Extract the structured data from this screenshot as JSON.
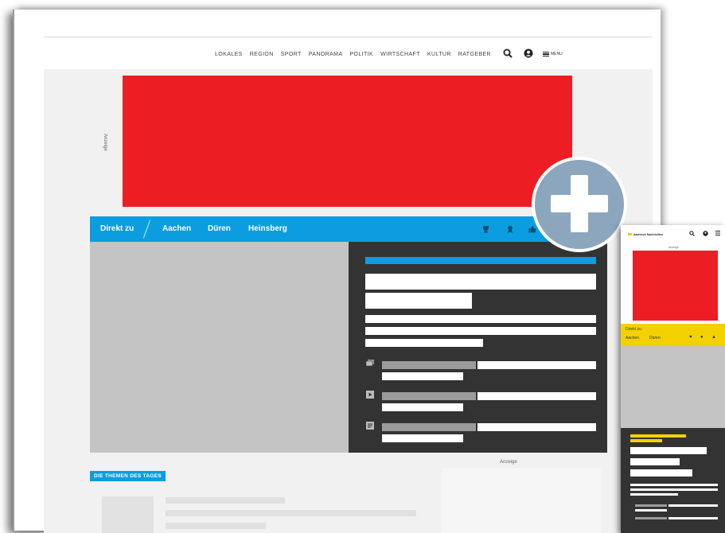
{
  "nav": {
    "items": [
      "LOKALES",
      "REGION",
      "SPORT",
      "PANORAMA",
      "POLITIK",
      "WIRTSCHAFT",
      "KULTUR",
      "RATGEBER"
    ],
    "menu_label": "MENU"
  },
  "ad": {
    "label": "Anzeige"
  },
  "quicklinks": {
    "label": "Direkt zu",
    "cities": [
      "Aachen",
      "Düren",
      "Heinsberg"
    ]
  },
  "section": {
    "title": "DIE THEMEN DES TAGES"
  },
  "sidebar_ad": {
    "label": "Anzeige"
  },
  "mobile": {
    "ad_label": "Anzeige",
    "quick_label": "Direkt zu",
    "cities": [
      "Aachen",
      "Düren"
    ]
  },
  "colors": {
    "accent_blue": "#0b9de0",
    "ad_red": "#ec1d23",
    "panel_dark": "#333333",
    "mobile_yellow": "#f3d100",
    "plus_badge": "#8ca7bd"
  }
}
